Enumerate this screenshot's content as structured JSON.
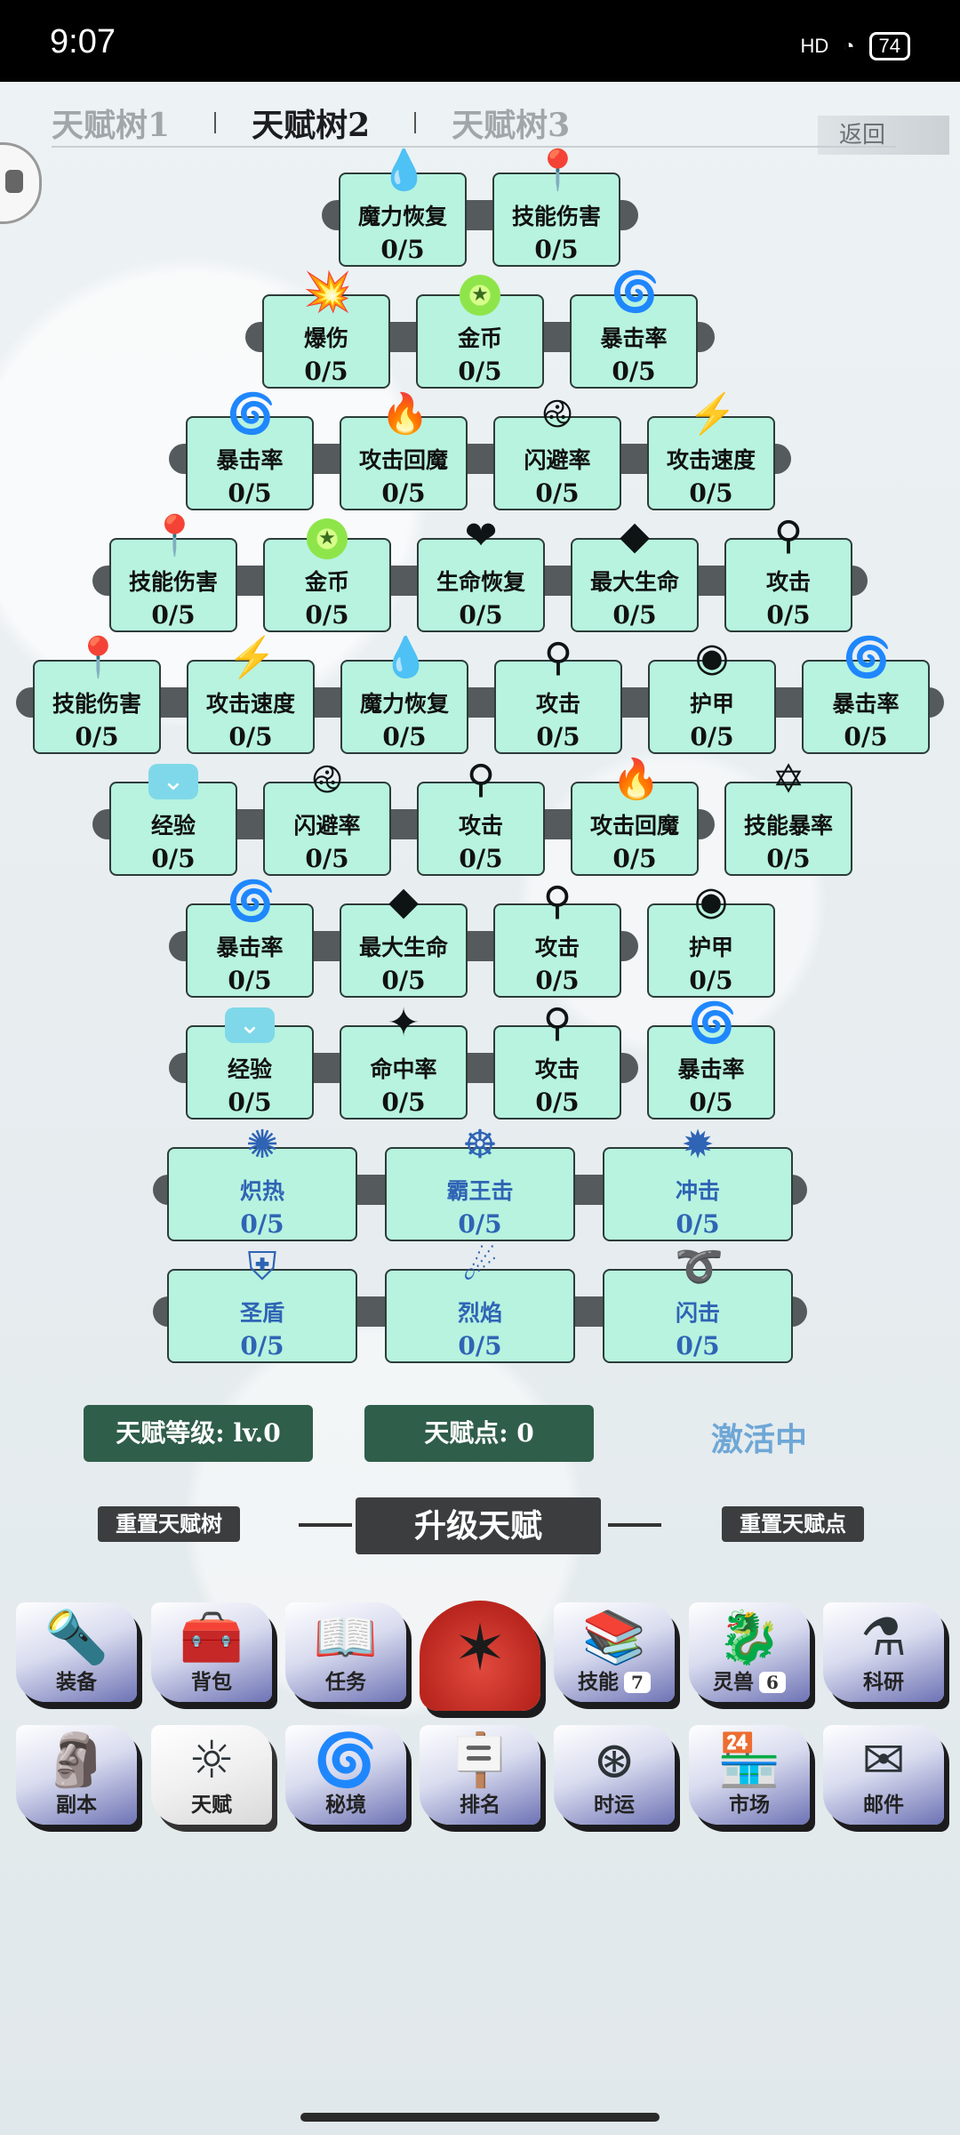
{
  "status": {
    "time": "9:07",
    "battery": "74",
    "signal": "HD"
  },
  "tabs": [
    "天赋树1",
    "天赋树2",
    "天赋树3"
  ],
  "back_label": "返回",
  "nodes": [
    {
      "name": "魔力恢复",
      "level": "0/5",
      "icon": "water-drop-icon",
      "glyph": "💧"
    },
    {
      "name": "技能伤害",
      "level": "0/5",
      "icon": "pin-blade-icon",
      "glyph": "📍"
    },
    {
      "name": "爆伤",
      "level": "0/5",
      "icon": "burst-icon",
      "glyph": "💥"
    },
    {
      "name": "金币",
      "level": "0/5",
      "icon": "coin-icon",
      "glyph": "★"
    },
    {
      "name": "暴击率",
      "level": "0/5",
      "icon": "spiral-icon",
      "glyph": "🌀"
    },
    {
      "name": "暴击率",
      "level": "0/5",
      "icon": "spiral-icon",
      "glyph": "🌀"
    },
    {
      "name": "攻击回魔",
      "level": "0/5",
      "icon": "flame-icon",
      "glyph": "🔥"
    },
    {
      "name": "闪避率",
      "level": "0/5",
      "icon": "triskele-icon",
      "glyph": "࿋"
    },
    {
      "name": "攻击速度",
      "level": "0/5",
      "icon": "lightning-icon",
      "glyph": "⚡"
    },
    {
      "name": "技能伤害",
      "level": "0/5",
      "icon": "pin-blade-icon",
      "glyph": "📍"
    },
    {
      "name": "金币",
      "level": "0/5",
      "icon": "coin-icon",
      "glyph": "★"
    },
    {
      "name": "生命恢复",
      "level": "0/5",
      "icon": "heart-plus-icon",
      "glyph": "❤"
    },
    {
      "name": "最大生命",
      "level": "0/5",
      "icon": "diamond-heart-icon",
      "glyph": "◆"
    },
    {
      "name": "攻击",
      "level": "0/5",
      "icon": "staff-icon",
      "glyph": "⚲"
    },
    {
      "name": "技能伤害",
      "level": "0/5",
      "icon": "pin-blade-icon",
      "glyph": "📍"
    },
    {
      "name": "攻击速度",
      "level": "0/5",
      "icon": "lightning-icon",
      "glyph": "⚡"
    },
    {
      "name": "魔力恢复",
      "level": "0/5",
      "icon": "water-drop-icon",
      "glyph": "💧"
    },
    {
      "name": "攻击",
      "level": "0/5",
      "icon": "staff-icon",
      "glyph": "⚲"
    },
    {
      "name": "护甲",
      "level": "0/5",
      "icon": "shield-ring-icon",
      "glyph": "◉"
    },
    {
      "name": "暴击率",
      "level": "0/5",
      "icon": "spiral-icon",
      "glyph": "🌀"
    },
    {
      "name": "经验",
      "level": "0/5",
      "icon": "exp-chevron-icon",
      "glyph": "⌄"
    },
    {
      "name": "闪避率",
      "level": "0/5",
      "icon": "triskele-icon",
      "glyph": "࿋"
    },
    {
      "name": "攻击",
      "level": "0/5",
      "icon": "staff-icon",
      "glyph": "⚲"
    },
    {
      "name": "攻击回魔",
      "level": "0/5",
      "icon": "flame-icon",
      "glyph": "🔥"
    },
    {
      "name": "技能暴率",
      "level": "0/5",
      "icon": "hexagram-icon",
      "glyph": "✡"
    },
    {
      "name": "暴击率",
      "level": "0/5",
      "icon": "spiral-icon",
      "glyph": "🌀"
    },
    {
      "name": "最大生命",
      "level": "0/5",
      "icon": "diamond-heart-icon",
      "glyph": "◆"
    },
    {
      "name": "攻击",
      "level": "0/5",
      "icon": "staff-icon",
      "glyph": "⚲"
    },
    {
      "name": "护甲",
      "level": "0/5",
      "icon": "shield-ring-icon",
      "glyph": "◉"
    },
    {
      "name": "经验",
      "level": "0/5",
      "icon": "exp-chevron-icon",
      "glyph": "⌄"
    },
    {
      "name": "命中率",
      "level": "0/5",
      "icon": "star-target-icon",
      "glyph": "✦"
    },
    {
      "name": "攻击",
      "level": "0/5",
      "icon": "staff-icon",
      "glyph": "⚲"
    },
    {
      "name": "暴击率",
      "level": "0/5",
      "icon": "spiral-icon",
      "glyph": "🌀"
    },
    {
      "name": "炽热",
      "level": "0/5",
      "icon": "blue-blaze-icon",
      "glyph": "✺"
    },
    {
      "name": "霸王击",
      "level": "0/5",
      "icon": "warrior-icon",
      "glyph": "☸"
    },
    {
      "name": "冲击",
      "level": "0/5",
      "icon": "impact-icon",
      "glyph": "✹"
    },
    {
      "name": "圣盾",
      "level": "0/5",
      "icon": "holy-shield-icon",
      "glyph": "⛨"
    },
    {
      "name": "烈焰",
      "level": "0/5",
      "icon": "fireball-icon",
      "glyph": "☄"
    },
    {
      "name": "闪击",
      "level": "0/5",
      "icon": "swirl-strike-icon",
      "glyph": "➰"
    }
  ],
  "talent_level": "天赋等级: lv.0",
  "talent_points": "天赋点: 0",
  "status_active": "激活中",
  "reset_tree": "重置天赋树",
  "upgrade": "升级天赋",
  "reset_points": "重置天赋点",
  "nav": [
    {
      "label": "装备",
      "icon": "torch-icon",
      "glyph": "🔦"
    },
    {
      "label": "背包",
      "icon": "chest-icon",
      "glyph": "🧰"
    },
    {
      "label": "任务",
      "icon": "book-icon",
      "glyph": "📖"
    },
    {
      "label": "",
      "icon": "phoenix-icon",
      "glyph": "✶"
    },
    {
      "label": "技能",
      "badge": "7",
      "icon": "skillbook-icon",
      "glyph": "📚"
    },
    {
      "label": "灵兽",
      "badge": "6",
      "icon": "dragon-icon",
      "glyph": "🐉"
    },
    {
      "label": "科研",
      "icon": "flask-icon",
      "glyph": "⚗"
    },
    {
      "label": "副本",
      "icon": "totem-icon",
      "glyph": "🗿"
    },
    {
      "label": "天赋",
      "icon": "eye-sun-icon",
      "glyph": "☼"
    },
    {
      "label": "秘境",
      "icon": "vortex-icon",
      "glyph": "🌀"
    },
    {
      "label": "排名",
      "icon": "signboard-icon",
      "glyph": "🪧"
    },
    {
      "label": "时运",
      "icon": "fortune-wheel-icon",
      "glyph": "⊛"
    },
    {
      "label": "市场",
      "icon": "shop-icon",
      "glyph": "🏪"
    },
    {
      "label": "邮件",
      "icon": "mail-icon",
      "glyph": "✉"
    }
  ]
}
